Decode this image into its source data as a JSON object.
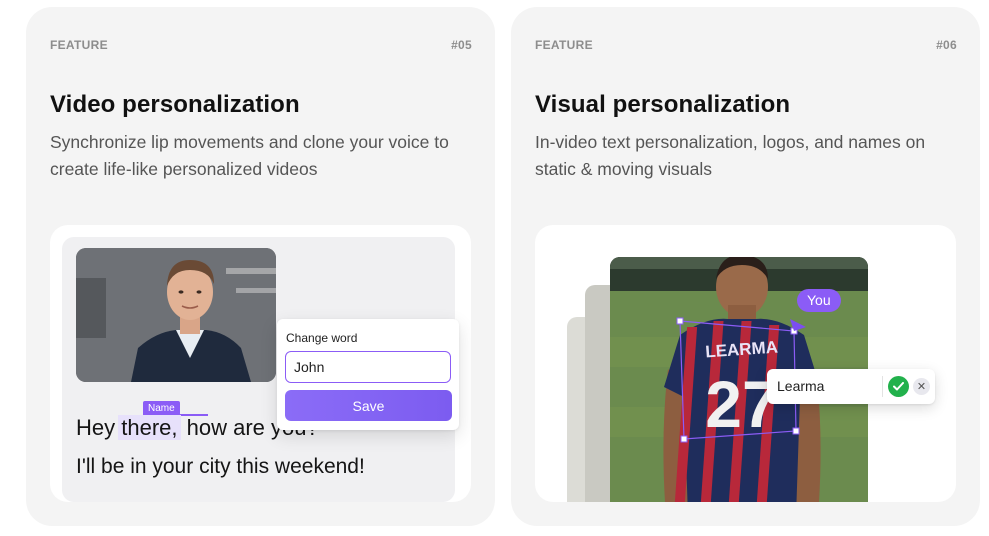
{
  "cards": [
    {
      "tag": "FEATURE",
      "number": "#05",
      "title": "Video personalization",
      "description": "Synchronize lip movements and clone your voice to create life-like personalized videos",
      "illustration": {
        "name_tag": "Name",
        "line1_before": "Hey ",
        "line1_highlight": "there,",
        "line1_after": " how are you?",
        "line2": "I'll be in your city this weekend!",
        "popup": {
          "label": "Change word",
          "input_value": "John",
          "button_label": "Save"
        }
      }
    },
    {
      "tag": "FEATURE",
      "number": "#06",
      "title": "Visual personalization",
      "description": "In-video text personalization, logos, and names on static & moving visuals",
      "illustration": {
        "bubble": "You",
        "jersey_name": "LEARMA",
        "jersey_number": "27",
        "input_value": "Learma",
        "confirm_icon": "check-icon",
        "cancel_icon": "close-icon",
        "cancel_glyph": "✕"
      }
    }
  ],
  "colors": {
    "accent": "#8b5cf6",
    "card_bg": "#f4f4f4",
    "success": "#22b14c"
  }
}
